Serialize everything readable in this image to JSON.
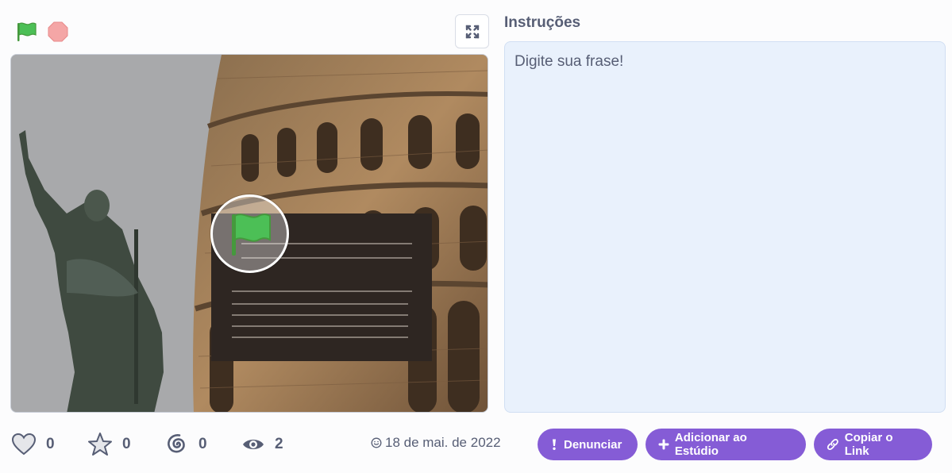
{
  "instructions": {
    "title": "Instruções",
    "body": "Digite sua frase!"
  },
  "stats": {
    "loves": "0",
    "favorites": "0",
    "remixes": "0",
    "views": "2"
  },
  "date": "18 de mai. de 2022",
  "actions": {
    "report": "Denunciar",
    "add_to_studio": "Adicionar ao Estúdio",
    "copy_link": "Copiar o Link"
  },
  "colors": {
    "accent": "#855cd6",
    "flag_green": "#4cbf56",
    "stop_red": "#ec5959",
    "text": "#575e75",
    "instructions_bg": "#e9f1fc"
  },
  "icons": [
    "green-flag-icon",
    "stop-icon",
    "fullscreen-icon",
    "heart-icon",
    "star-icon",
    "remix-icon",
    "eye-icon",
    "date-icon",
    "report-icon",
    "plus-icon",
    "link-icon"
  ]
}
